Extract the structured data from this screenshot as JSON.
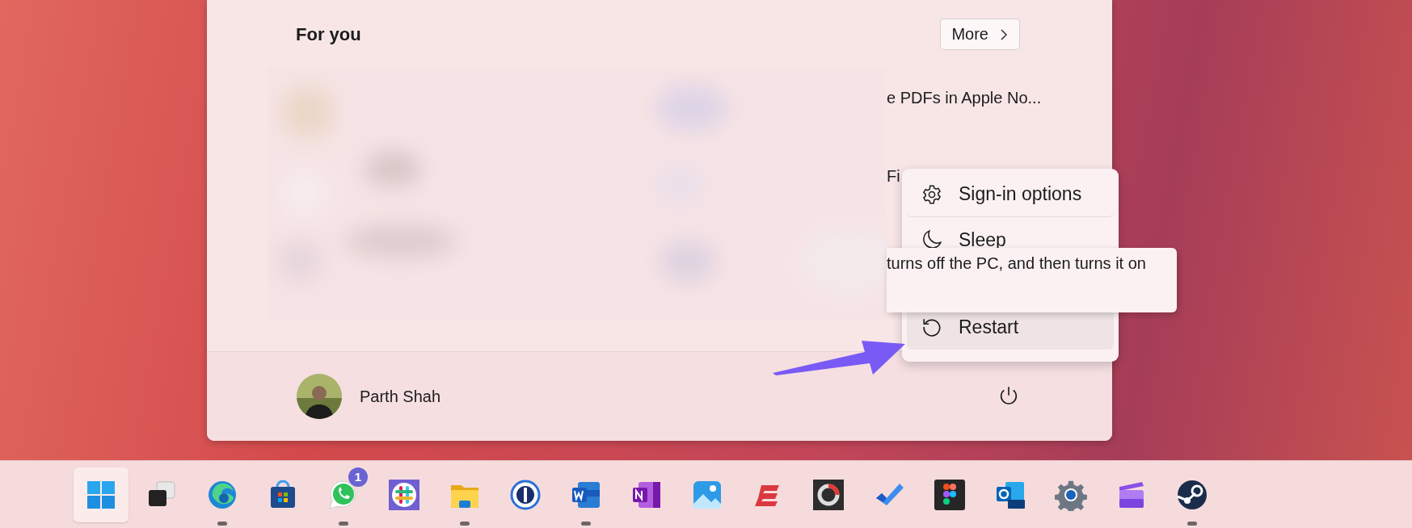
{
  "start_menu": {
    "section_title": "For you",
    "more_button": "More",
    "recommended": [
      "e PDFs in Apple No...",
      "Fi"
    ],
    "user": {
      "name": "Parth Shah"
    }
  },
  "power_menu": {
    "items": [
      {
        "label": "Sign-in options",
        "selected": false
      },
      {
        "label": "Sleep",
        "selected": false
      },
      {
        "label": "Restart",
        "selected": true
      }
    ],
    "tooltip": "turns off the PC, and then turns it on"
  },
  "taskbar": {
    "apps": [
      {
        "selected": true,
        "running": false
      },
      {
        "selected": false,
        "running": false
      },
      {
        "selected": false,
        "running": true
      },
      {
        "selected": false,
        "running": false
      },
      {
        "selected": false,
        "running": true,
        "badge": "1"
      },
      {
        "selected": false,
        "running": false
      },
      {
        "selected": false,
        "running": true
      },
      {
        "selected": false,
        "running": false
      },
      {
        "selected": false,
        "running": true
      },
      {
        "selected": false,
        "running": false
      },
      {
        "selected": false,
        "running": false
      },
      {
        "selected": false,
        "running": false
      },
      {
        "selected": false,
        "running": false
      },
      {
        "selected": false,
        "running": false
      },
      {
        "selected": false,
        "running": false
      },
      {
        "selected": false,
        "running": false
      },
      {
        "selected": false,
        "running": false
      },
      {
        "selected": false,
        "running": false
      },
      {
        "selected": false,
        "running": true
      }
    ]
  }
}
